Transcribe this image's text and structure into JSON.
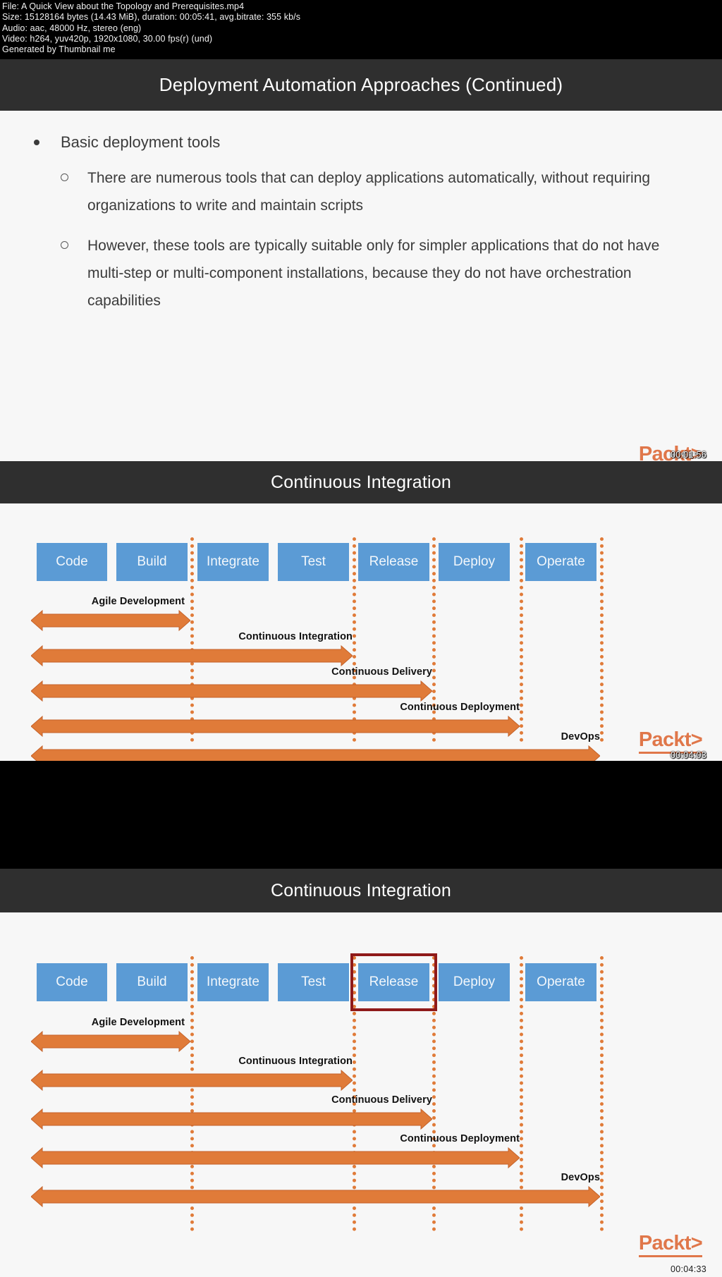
{
  "video_meta": {
    "file": "File: A Quick View about the Topology and Prerequisites.mp4",
    "size": "Size: 15128164 bytes (14.43 MiB), duration: 00:05:41, avg.bitrate: 355 kb/s",
    "audio": "Audio: aac, 48000 Hz, stereo (eng)",
    "video": "Video: h264, yuv420p, 1920x1080, 30.00 fps(r) (und)",
    "generator": "Generated by Thumbnail me"
  },
  "brand": {
    "logo_text": "Packt>",
    "accent": "#e0774a"
  },
  "slides": [
    {
      "title": "Deployment Automation Approaches (Continued)",
      "timestamp": "00:01:56",
      "bullets": {
        "level1": "Basic deployment tools",
        "level2": [
          "There are numerous tools that can deploy applications automatically, without requiring organizations to write and maintain scripts",
          "However, these tools are typically suitable only for simpler applications that do not have multi-step or multi-component installations, because they do not have orchestration capabilities"
        ]
      }
    },
    {
      "title": "Continuous Integration",
      "timestamp": "00:04:03",
      "highlight": null
    },
    {
      "title": "Continuous Integration",
      "timestamp": "00:04:33",
      "highlight": "Release"
    }
  ],
  "chart_data": {
    "type": "diagram",
    "title": "Continuous Integration",
    "stage_color": "#5b9bd5",
    "arrow_color": "#e07b39",
    "divider_color": "#e07b39",
    "highlight_color": "#8f1a1a",
    "stages": [
      "Code",
      "Build",
      "Integrate",
      "Test",
      "Release",
      "Deploy",
      "Operate"
    ],
    "scopes": [
      {
        "label": "Agile Development",
        "from_stage": "Code",
        "to_stage": "Build"
      },
      {
        "label": "Continuous Integration",
        "from_stage": "Code",
        "to_stage": "Test"
      },
      {
        "label": "Continuous Delivery",
        "from_stage": "Code",
        "to_stage": "Release"
      },
      {
        "label": "Continuous Deployment",
        "from_stage": "Code",
        "to_stage": "Deploy"
      },
      {
        "label": "DevOps",
        "from_stage": "Code",
        "to_stage": "Operate"
      }
    ]
  }
}
